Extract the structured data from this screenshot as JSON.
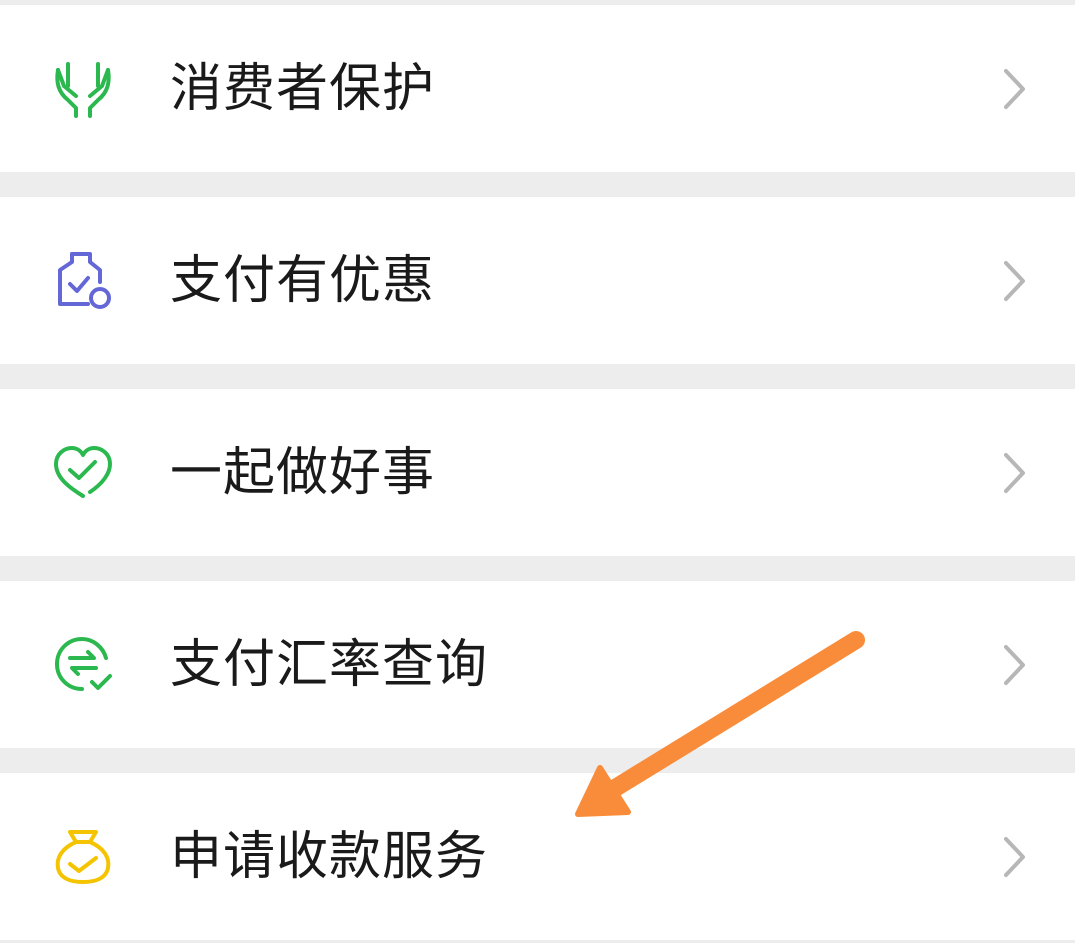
{
  "menu": {
    "items": [
      {
        "label": "消费者保护",
        "icon": "hands-protect-icon",
        "color": "#2bb84f"
      },
      {
        "label": "支付有优惠",
        "icon": "discount-clipboard-icon",
        "color": "#6467d6"
      },
      {
        "label": "一起做好事",
        "icon": "heart-check-icon",
        "color": "#2bb84f"
      },
      {
        "label": "支付汇率查询",
        "icon": "exchange-rate-icon",
        "color": "#2bb84f"
      },
      {
        "label": "申请收款服务",
        "icon": "money-bag-icon",
        "color": "#f5c400"
      }
    ]
  },
  "colors": {
    "chevron": "#b7b7b7",
    "annotation_arrow": "#f98c3a",
    "separator": "#ededed"
  }
}
